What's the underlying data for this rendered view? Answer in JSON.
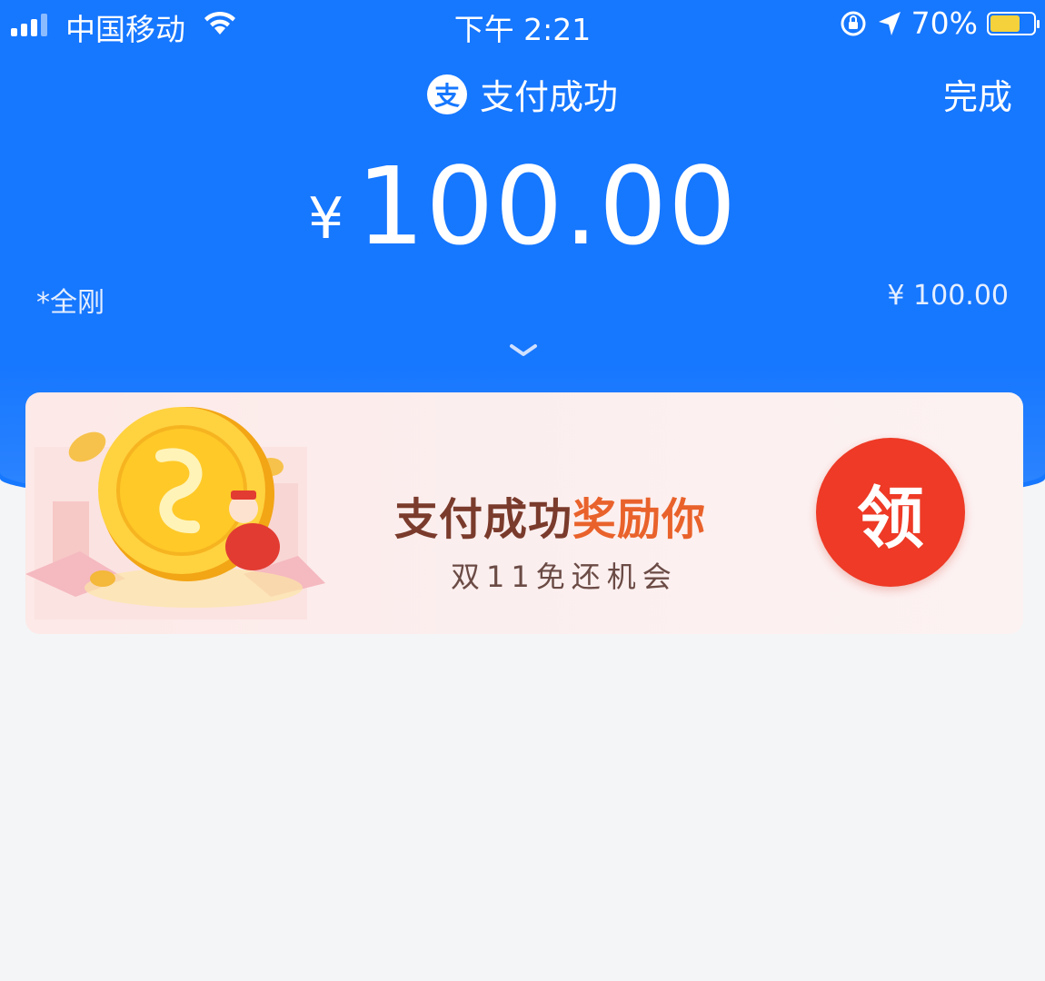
{
  "status_bar": {
    "carrier": "中国移动",
    "time": "下午 2:21",
    "battery_percent": "70%",
    "battery_level": 0.7,
    "icons": [
      "signal-icon",
      "wifi-icon",
      "orientation-lock-icon",
      "location-icon",
      "battery-charging-icon"
    ]
  },
  "nav": {
    "title": "支付成功",
    "logo_glyph": "支",
    "done_label": "完成"
  },
  "payment": {
    "currency": "¥",
    "amount": "100.00",
    "payee": "*全刚",
    "payee_amount": "¥ 100.00"
  },
  "promo": {
    "title_main": "支付成功",
    "title_highlight": "奖励你",
    "subtitle": "双11免还机会",
    "claim_label": "领"
  },
  "colors": {
    "primary_blue": "#1677ff",
    "claim_red": "#ee3a26",
    "promo_highlight": "#e9622b",
    "page_background": "#f4f5f7"
  }
}
